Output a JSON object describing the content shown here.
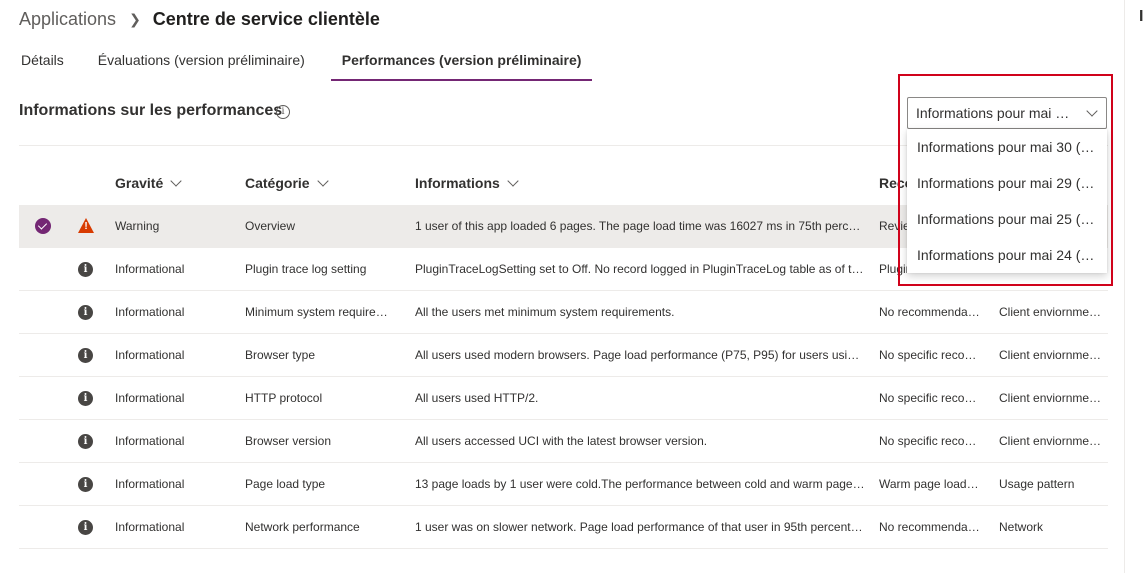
{
  "breadcrumb": {
    "root": "Applications",
    "current": "Centre de service clientèle"
  },
  "tabs": [
    "Détails",
    "Évaluations (version préliminaire)",
    "Performances (version préliminaire)"
  ],
  "selected_tab_index": 2,
  "section": {
    "title": "Informations sur les performances",
    "info_icon": "info-icon"
  },
  "columns": [
    "Gravité",
    "Catégorie",
    "Informations",
    "Reco"
  ],
  "rows": [
    {
      "severity": "Warning",
      "category": "Overview",
      "info": "1 user of this app loaded 6 pages. The page load time was 16027 ms in 75th perce…",
      "reco": "Revie",
      "type": "",
      "selected": true
    },
    {
      "severity": "Informational",
      "category": "Plugin trace log setting",
      "info": "PluginTraceLogSetting set to Off. No record logged in PluginTraceLog table as of t…",
      "reco": "Plugin",
      "type": ""
    },
    {
      "severity": "Informational",
      "category": "Minimum system require…",
      "info": "All the users met minimum system requirements.",
      "reco": "No recommenda…",
      "type": "Client enviornme…"
    },
    {
      "severity": "Informational",
      "category": "Browser type",
      "info": "All users used modern browsers. Page load performance (P75, P95) for users using…",
      "reco": "No specific reco…",
      "type": "Client enviornme…"
    },
    {
      "severity": "Informational",
      "category": "HTTP protocol",
      "info": "All users used HTTP/2.",
      "reco": "No specific reco…",
      "type": "Client enviornme…"
    },
    {
      "severity": "Informational",
      "category": "Browser version",
      "info": "All users accessed UCI with the latest browser version.",
      "reco": "No specific reco…",
      "type": "Client enviornme…"
    },
    {
      "severity": "Informational",
      "category": "Page load type",
      "info": "13 page loads by 1 user were cold.The performance between cold and warm page…",
      "reco": "Warm page load…",
      "type": "Usage pattern"
    },
    {
      "severity": "Informational",
      "category": "Network performance",
      "info": "1 user was on slower network. Page load performance of that user in 95th percent…",
      "reco": "No recommenda…",
      "type": "Network"
    }
  ],
  "dropdown": {
    "selected": "Informations pour mai 3…",
    "options": [
      "Informations pour mai 30 (…",
      "Informations pour mai 29 (…",
      "Informations pour mai 25 (…",
      "Informations pour mai 24 (…"
    ]
  },
  "colors": {
    "accent": "#742774",
    "warning": "#d83b01",
    "highlight_box": "#d0021b"
  }
}
